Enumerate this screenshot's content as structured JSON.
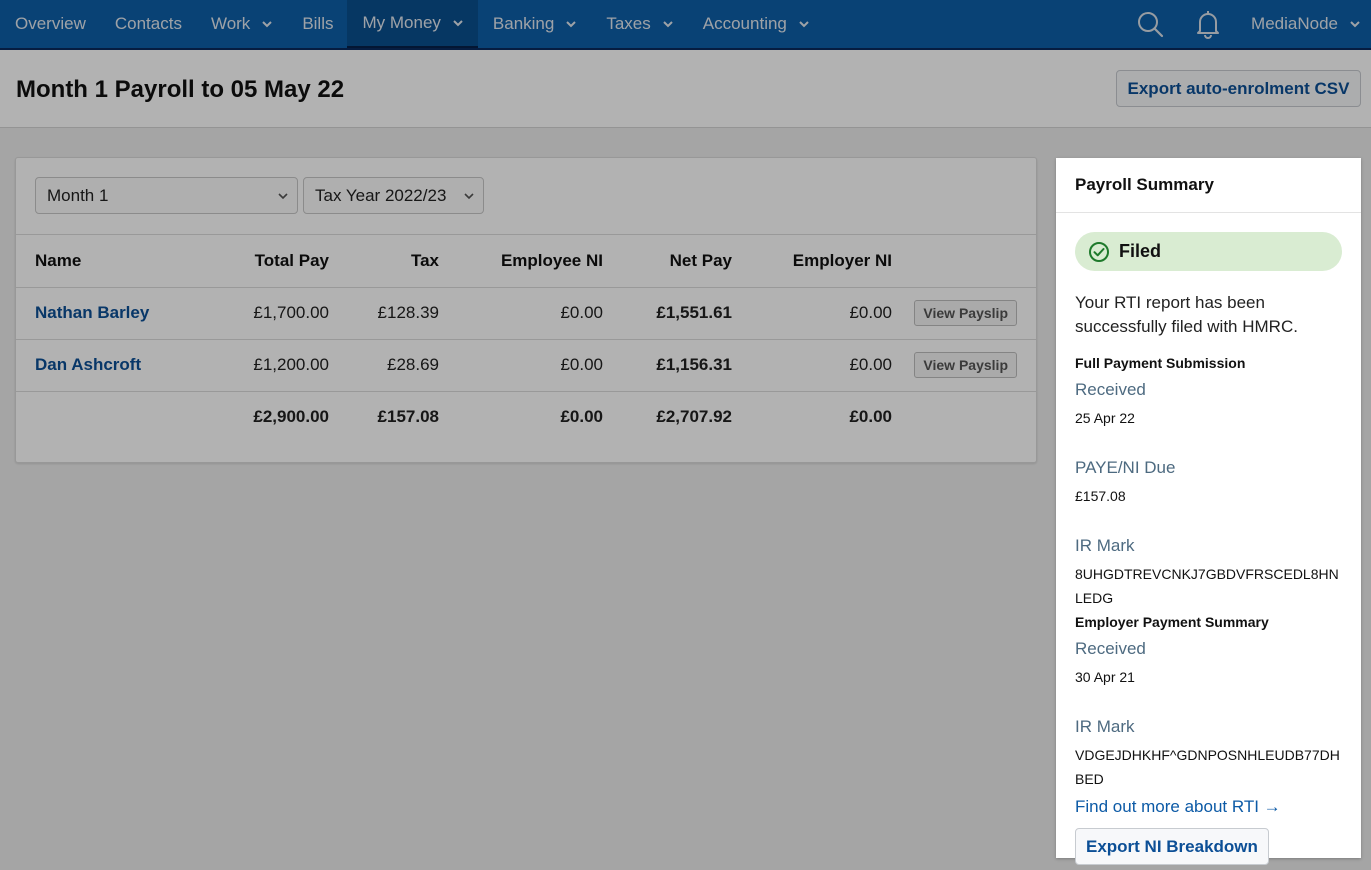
{
  "nav": {
    "items": [
      {
        "label": "Overview",
        "dropdown": false,
        "active": false
      },
      {
        "label": "Contacts",
        "dropdown": false,
        "active": false
      },
      {
        "label": "Work",
        "dropdown": true,
        "active": false
      },
      {
        "label": "Bills",
        "dropdown": false,
        "active": false
      },
      {
        "label": "My Money",
        "dropdown": true,
        "active": true
      },
      {
        "label": "Banking",
        "dropdown": true,
        "active": false
      },
      {
        "label": "Taxes",
        "dropdown": true,
        "active": false
      },
      {
        "label": "Accounting",
        "dropdown": true,
        "active": false
      }
    ],
    "icons": [
      "search-icon",
      "bell-icon"
    ],
    "account_label": "MediaNode"
  },
  "header": {
    "title": "Month 1 Payroll to 05 May 22",
    "export_csv_label": "Export auto-enrolment CSV"
  },
  "filters": {
    "period": "Month 1",
    "tax_year": "Tax Year 2022/23"
  },
  "table": {
    "columns": [
      "Name",
      "Total Pay",
      "Tax",
      "Employee NI",
      "Net Pay",
      "Employer NI"
    ],
    "rows": [
      {
        "name": "Nathan Barley",
        "total_pay": "£1,700.00",
        "tax": "£128.39",
        "employee_ni": "£0.00",
        "net_pay": "£1,551.61",
        "employer_ni": "£0.00",
        "action": "View Payslip"
      },
      {
        "name": "Dan Ashcroft",
        "total_pay": "£1,200.00",
        "tax": "£28.69",
        "employee_ni": "£0.00",
        "net_pay": "£1,156.31",
        "employer_ni": "£0.00",
        "action": "View Payslip"
      }
    ],
    "totals": {
      "total_pay": "£2,900.00",
      "tax": "£157.08",
      "employee_ni": "£0.00",
      "net_pay": "£2,707.92",
      "employer_ni": "£0.00"
    }
  },
  "summary": {
    "title": "Payroll Summary",
    "status": "Filed",
    "status_color": "#d9ecd2",
    "message": "Your RTI report has been successfully filed with HMRC.",
    "fps": {
      "title": "Full Payment Submission",
      "received_label": "Received",
      "received_value": "25 Apr 22",
      "due_label": "PAYE/NI Due",
      "due_value": "£157.08",
      "irmark_label": "IR Mark",
      "irmark_value": "8UHGDTREVCNKJ7GBDVFRSCEDL8HNLEDG"
    },
    "eps": {
      "title": "Employer Payment Summary",
      "received_label": "Received",
      "received_value": "30 Apr 21",
      "irmark_label": "IR Mark",
      "irmark_value": "VDGEJDHKHF^GDNPOSNHLEUDB77DHBED"
    },
    "rti_link": "Find out more about RTI →",
    "export_ni_label": "Export NI Breakdown"
  },
  "colors": {
    "nav_bg": "#0e5fa8",
    "link": "#0c4f96",
    "filed_badge": "#d9ecd2",
    "filed_check": "#1f7a2c"
  }
}
